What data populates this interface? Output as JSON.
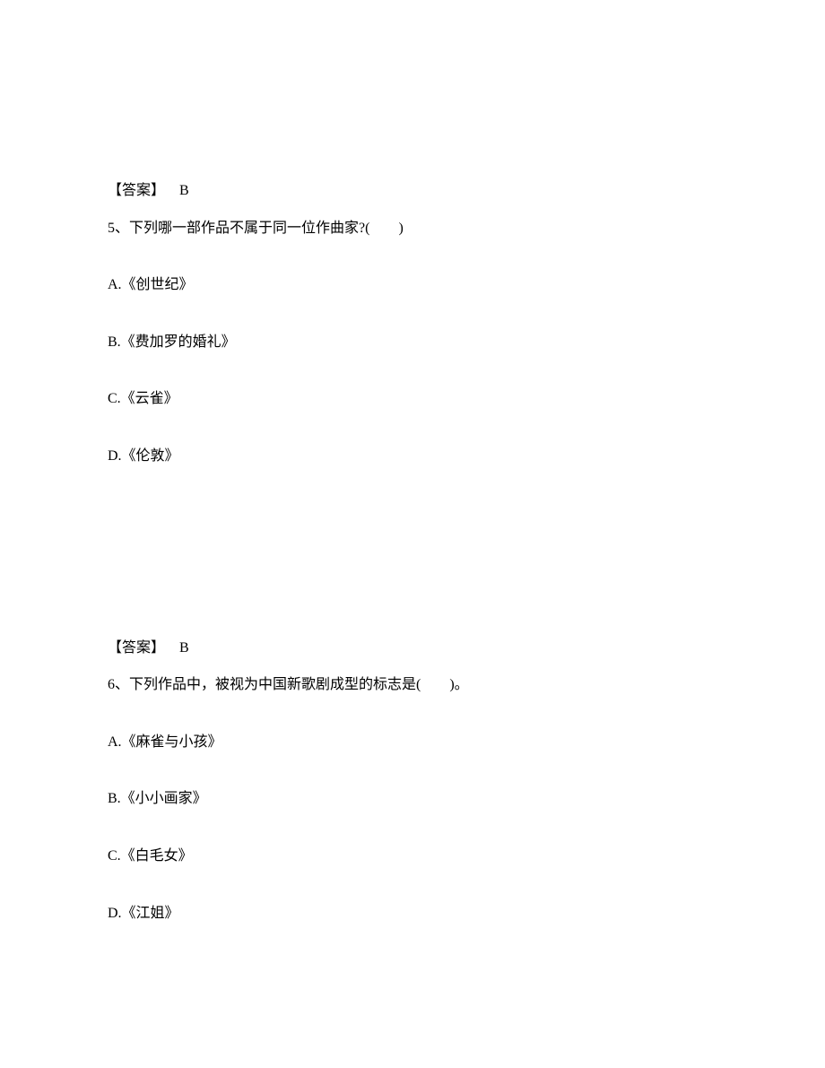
{
  "q5": {
    "prev_answer_label": "【答案】",
    "prev_answer_value": "B",
    "number": "5、",
    "stem": "下列哪一部作品不属于同一位作曲家?(　　)",
    "options": {
      "a": "A.《创世纪》",
      "b": "B.《费加罗的婚礼》",
      "c": "C.《云雀》",
      "d": "D.《伦敦》"
    },
    "answer_label": "【答案】",
    "answer_value": "B"
  },
  "q6": {
    "number": "6、",
    "stem": "下列作品中，被视为中国新歌剧成型的标志是(　　)。",
    "options": {
      "a": "A.《麻雀与小孩》",
      "b": "B.《小小画家》",
      "c": "C.《白毛女》",
      "d": "D.《江姐》"
    }
  }
}
